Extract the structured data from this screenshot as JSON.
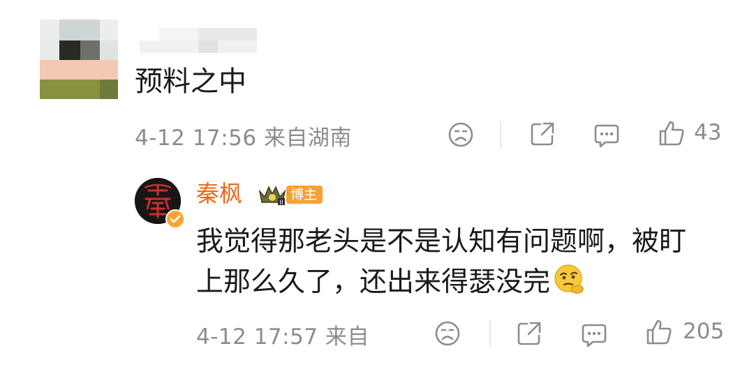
{
  "first_comment": {
    "text": "预料之中",
    "time": "4-12 17:56",
    "location": "来自湖南",
    "like_count": "43",
    "icons": {
      "dislike": "sad-face-icon",
      "share": "share-icon",
      "comment": "comment-icon",
      "like": "thumbs-up-icon"
    }
  },
  "reply": {
    "author": "秦枫",
    "badge_label": "博主",
    "text_line1": "我觉得那老头是不是认知有问题啊，被盯",
    "text_line2": "上那么久了，还出来得瑟没完",
    "emoji": "thinking-face-icon",
    "time": "4-12 17:57",
    "location": "来自",
    "like_count": "205"
  },
  "colors": {
    "author_name": "#e86a1c",
    "blogger_tag_bg": "#f5a13a",
    "meta_text": "#8c8c8c",
    "body_text": "#1a1a1a"
  }
}
